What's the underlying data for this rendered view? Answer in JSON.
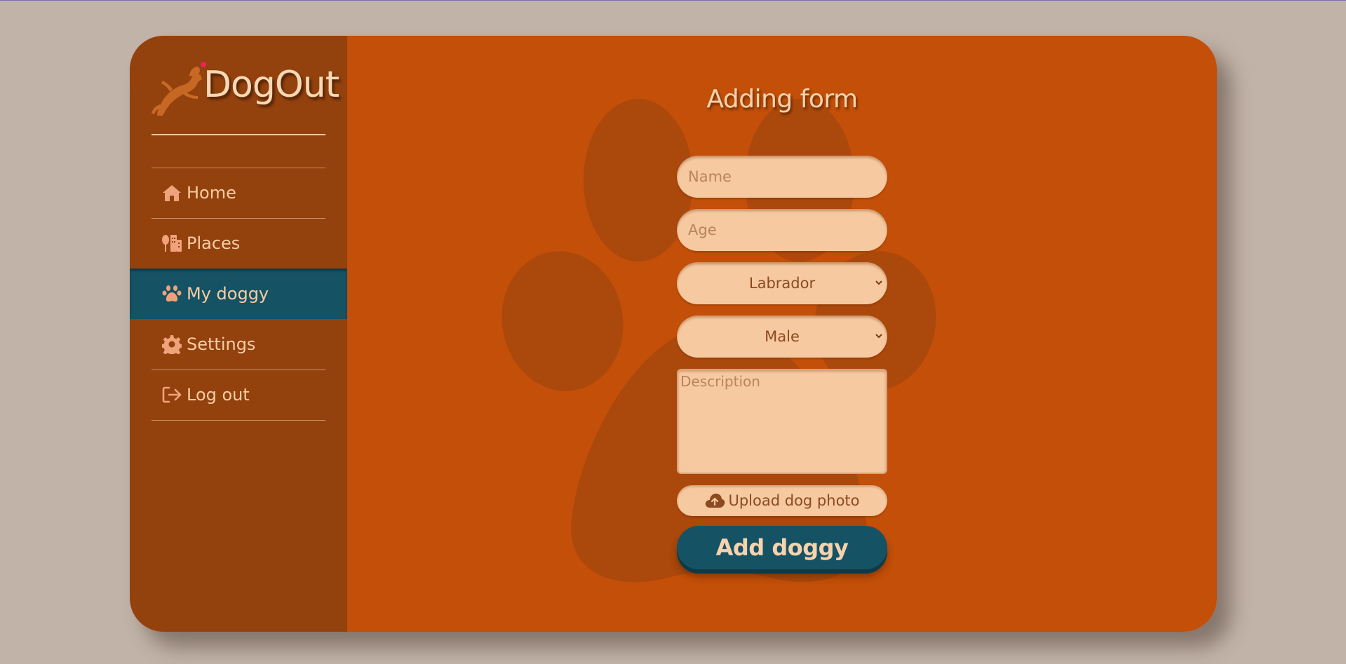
{
  "brand": {
    "name": "DogOut"
  },
  "sidebar": {
    "items": [
      {
        "label": "Home",
        "icon": "home-icon",
        "active": false
      },
      {
        "label": "Places",
        "icon": "places-icon",
        "active": false
      },
      {
        "label": "My doggy",
        "icon": "paw-icon",
        "active": true
      },
      {
        "label": "Settings",
        "icon": "gear-icon",
        "active": false
      },
      {
        "label": "Log out",
        "icon": "logout-icon",
        "active": false
      }
    ]
  },
  "form": {
    "title": "Adding form",
    "name_placeholder": "Name",
    "age_placeholder": "Age",
    "breed_value": "Labrador",
    "sex_value": "Male",
    "description_placeholder": "Description",
    "upload_label": "Upload dog photo",
    "submit_label": "Add doggy"
  },
  "colors": {
    "page_bg": "#c2b3a8",
    "sidebar_bg": "#93410d",
    "main_bg": "#c34f08",
    "accent": "#155264",
    "field_bg": "#f6c9a0",
    "text_light": "#f7d3ad"
  }
}
